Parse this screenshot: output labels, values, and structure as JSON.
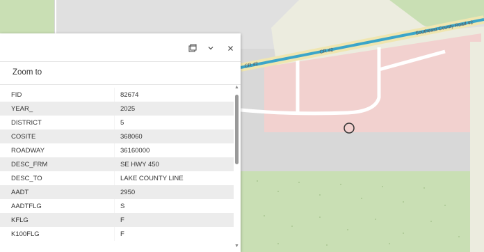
{
  "map": {
    "road_label": "CR 42",
    "road_label_left": "CR 42",
    "road_label_right": "Southeast County Road 42",
    "colors": {
      "background": "#d8d8d8",
      "parcel": "#f2d1cf",
      "road_highway": "#3ba5c9",
      "road_casing": "#f0e6b0",
      "vegetation": "#c9dfb4",
      "pale": "#ececdf"
    }
  },
  "popup": {
    "title": "",
    "dock_icon": "dock-icon",
    "collapse_icon": "chevron-down-icon",
    "close_icon": "close-icon",
    "zoom_to_label": "Zoom to",
    "fields": [
      {
        "name": "FID",
        "value": "82674"
      },
      {
        "name": "YEAR_",
        "value": "2025"
      },
      {
        "name": "DISTRICT",
        "value": "5"
      },
      {
        "name": "COSITE",
        "value": "368060"
      },
      {
        "name": "ROADWAY",
        "value": "36160000"
      },
      {
        "name": "DESC_FRM",
        "value": "SE HWY 450"
      },
      {
        "name": "DESC_TO",
        "value": "LAKE COUNTY LINE"
      },
      {
        "name": "AADT",
        "value": "2950"
      },
      {
        "name": "AADTFLG",
        "value": "S"
      },
      {
        "name": "KFLG",
        "value": "F"
      },
      {
        "name": "K100FLG",
        "value": "F"
      }
    ]
  }
}
